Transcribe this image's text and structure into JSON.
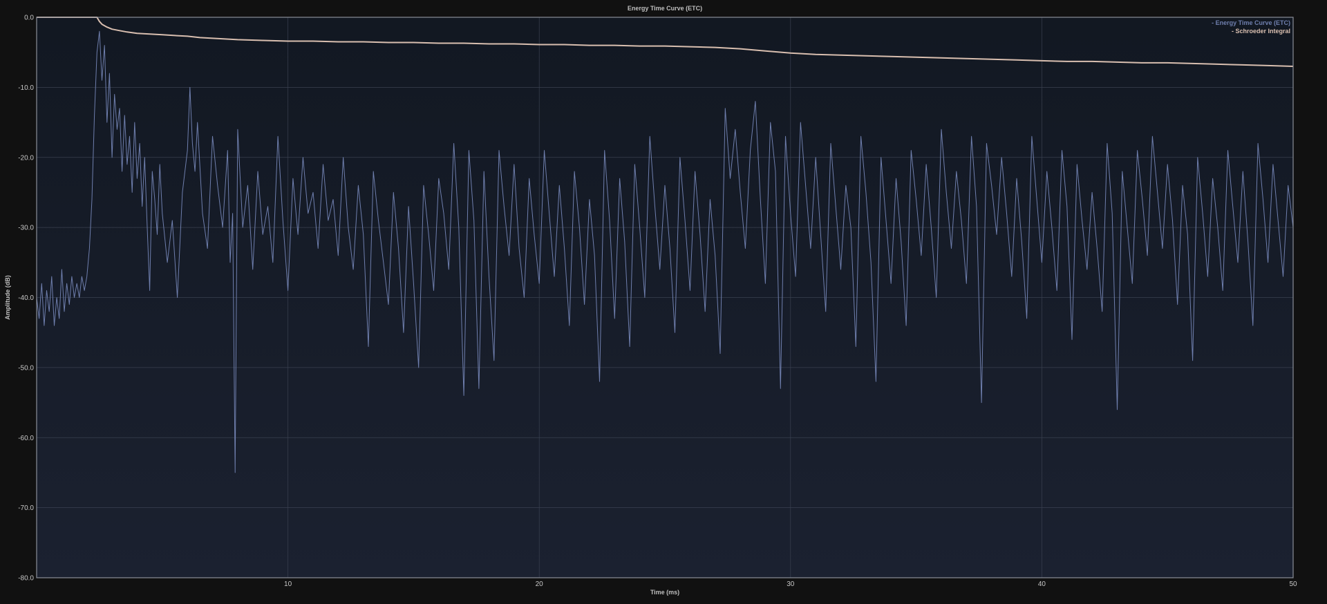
{
  "chart_data": {
    "type": "line",
    "title": "Energy Time Curve (ETC)",
    "xlabel": "Time (ms)",
    "ylabel": "Amplitude (dB)",
    "xlim": [
      0,
      50
    ],
    "ylim": [
      -80,
      0
    ],
    "x_ticks": [
      10,
      20,
      30,
      40,
      50
    ],
    "x_tick_labels": [
      "10",
      "20",
      "30",
      "40",
      "50"
    ],
    "y_ticks": [
      0,
      -10,
      -20,
      -30,
      -40,
      -50,
      -60,
      -70,
      -80
    ],
    "y_tick_labels": [
      "0.0",
      "-10.0",
      "-20.0",
      "-30.0",
      "-40.0",
      "-50.0",
      "-60.0",
      "-70.0",
      "-80.0"
    ],
    "grid": true,
    "legend_position": "top-right",
    "background": "#151b27",
    "grid_color": "#3a4150",
    "axis_color": "#8a8f99",
    "series": [
      {
        "name": "Energy Time Curve (ETC)",
        "legend_label": "- Energy Time Curve (ETC)",
        "color": "#6f7fae",
        "x": [
          0,
          0.1,
          0.2,
          0.3,
          0.4,
          0.5,
          0.6,
          0.7,
          0.8,
          0.9,
          1.0,
          1.1,
          1.2,
          1.3,
          1.4,
          1.5,
          1.6,
          1.7,
          1.8,
          1.9,
          2.0,
          2.1,
          2.2,
          2.3,
          2.4,
          2.5,
          2.6,
          2.7,
          2.8,
          2.9,
          3.0,
          3.1,
          3.2,
          3.3,
          3.4,
          3.5,
          3.6,
          3.7,
          3.8,
          3.9,
          4.0,
          4.1,
          4.2,
          4.3,
          4.4,
          4.5,
          4.6,
          4.7,
          4.8,
          4.9,
          5.0,
          5.2,
          5.4,
          5.6,
          5.8,
          6.0,
          6.1,
          6.2,
          6.3,
          6.4,
          6.6,
          6.8,
          7.0,
          7.2,
          7.4,
          7.6,
          7.7,
          7.8,
          7.9,
          8.0,
          8.2,
          8.4,
          8.6,
          8.8,
          9.0,
          9.2,
          9.4,
          9.6,
          9.8,
          10.0,
          10.2,
          10.4,
          10.6,
          10.8,
          11.0,
          11.2,
          11.4,
          11.6,
          11.8,
          12.0,
          12.2,
          12.4,
          12.6,
          12.8,
          13.0,
          13.2,
          13.4,
          13.6,
          13.8,
          14.0,
          14.2,
          14.4,
          14.6,
          14.8,
          15.0,
          15.2,
          15.4,
          15.6,
          15.8,
          16.0,
          16.2,
          16.4,
          16.6,
          16.8,
          17.0,
          17.2,
          17.4,
          17.6,
          17.8,
          18.0,
          18.2,
          18.4,
          18.6,
          18.8,
          19.0,
          19.2,
          19.4,
          19.6,
          19.8,
          20.0,
          20.2,
          20.4,
          20.6,
          20.8,
          21.0,
          21.2,
          21.4,
          21.6,
          21.8,
          22.0,
          22.2,
          22.4,
          22.6,
          22.8,
          23.0,
          23.2,
          23.4,
          23.6,
          23.8,
          24.0,
          24.2,
          24.4,
          24.6,
          24.8,
          25.0,
          25.2,
          25.4,
          25.6,
          25.8,
          26.0,
          26.2,
          26.4,
          26.6,
          26.8,
          27.0,
          27.2,
          27.4,
          27.6,
          27.8,
          28.0,
          28.2,
          28.4,
          28.6,
          28.8,
          29.0,
          29.2,
          29.4,
          29.6,
          29.8,
          30.0,
          30.2,
          30.4,
          30.6,
          30.8,
          31.0,
          31.2,
          31.4,
          31.6,
          31.8,
          32.0,
          32.2,
          32.4,
          32.6,
          32.8,
          33.0,
          33.2,
          33.4,
          33.6,
          33.8,
          34.0,
          34.2,
          34.4,
          34.6,
          34.8,
          35.0,
          35.2,
          35.4,
          35.6,
          35.8,
          36.0,
          36.2,
          36.4,
          36.6,
          36.8,
          37.0,
          37.2,
          37.4,
          37.6,
          37.8,
          38.0,
          38.2,
          38.4,
          38.6,
          38.8,
          39.0,
          39.2,
          39.4,
          39.6,
          39.8,
          40.0,
          40.2,
          40.4,
          40.6,
          40.8,
          41.0,
          41.2,
          41.4,
          41.6,
          41.8,
          42.0,
          42.2,
          42.4,
          42.6,
          42.8,
          43.0,
          43.2,
          43.4,
          43.6,
          43.8,
          44.0,
          44.2,
          44.4,
          44.6,
          44.8,
          45.0,
          45.2,
          45.4,
          45.6,
          45.8,
          46.0,
          46.2,
          46.4,
          46.6,
          46.8,
          47.0,
          47.2,
          47.4,
          47.6,
          47.8,
          48.0,
          48.2,
          48.4,
          48.6,
          48.8,
          49.0,
          49.2,
          49.4,
          49.6,
          49.8,
          50.0
        ],
        "values": [
          -40,
          -43,
          -38,
          -44,
          -39,
          -42,
          -37,
          -44,
          -40,
          -43,
          -36,
          -42,
          -38,
          -41,
          -37,
          -40,
          -38,
          -40,
          -37,
          -39,
          -37,
          -33,
          -26,
          -14,
          -5,
          -2,
          -9,
          -4,
          -15,
          -8,
          -20,
          -11,
          -16,
          -13,
          -22,
          -14,
          -21,
          -17,
          -25,
          -15,
          -23,
          -18,
          -27,
          -20,
          -30,
          -39,
          -22,
          -26,
          -31,
          -21,
          -28,
          -35,
          -29,
          -40,
          -25,
          -19,
          -10,
          -18,
          -22,
          -15,
          -28,
          -33,
          -17,
          -24,
          -30,
          -19,
          -35,
          -28,
          -65,
          -16,
          -30,
          -24,
          -36,
          -22,
          -31,
          -27,
          -35,
          -17,
          -29,
          -39,
          -23,
          -31,
          -20,
          -28,
          -25,
          -33,
          -21,
          -29,
          -26,
          -34,
          -20,
          -30,
          -36,
          -24,
          -31,
          -47,
          -22,
          -29,
          -35,
          -41,
          -25,
          -33,
          -45,
          -27,
          -38,
          -50,
          -24,
          -31,
          -39,
          -23,
          -28,
          -36,
          -18,
          -30,
          -54,
          -19,
          -29,
          -53,
          -22,
          -37,
          -49,
          -19,
          -27,
          -34,
          -21,
          -33,
          -40,
          -23,
          -31,
          -38,
          -19,
          -28,
          -37,
          -24,
          -33,
          -44,
          -22,
          -30,
          -41,
          -26,
          -34,
          -52,
          -19,
          -29,
          -43,
          -23,
          -32,
          -47,
          -21,
          -30,
          -40,
          -17,
          -27,
          -36,
          -24,
          -33,
          -45,
          -20,
          -29,
          -39,
          -22,
          -31,
          -42,
          -26,
          -34,
          -48,
          -13,
          -23,
          -16,
          -25,
          -33,
          -19,
          -12,
          -26,
          -38,
          -15,
          -22,
          -53,
          -17,
          -28,
          -37,
          -15,
          -24,
          -33,
          -20,
          -31,
          -42,
          -18,
          -27,
          -36,
          -24,
          -30,
          -47,
          -17,
          -25,
          -35,
          -52,
          -20,
          -29,
          -38,
          -23,
          -32,
          -44,
          -19,
          -26,
          -34,
          -21,
          -30,
          -40,
          -16,
          -25,
          -33,
          -22,
          -29,
          -38,
          -17,
          -27,
          -55,
          -18,
          -24,
          -31,
          -20,
          -28,
          -37,
          -23,
          -32,
          -43,
          -17,
          -26,
          -35,
          -22,
          -30,
          -39,
          -19,
          -27,
          -46,
          -21,
          -29,
          -36,
          -25,
          -33,
          -42,
          -18,
          -28,
          -56,
          -22,
          -30,
          -38,
          -19,
          -26,
          -34,
          -17,
          -25,
          -33,
          -21,
          -29,
          -41,
          -24,
          -31,
          -49,
          -20,
          -28,
          -37,
          -23,
          -30,
          -39,
          -19,
          -27,
          -35,
          -22,
          -32,
          -44,
          -18,
          -26,
          -35,
          -21,
          -29,
          -37,
          -24,
          -30
        ]
      },
      {
        "name": "Schroeder Integral",
        "legend_label": "- Schroeder Integral",
        "color": "#d9bfb0",
        "x": [
          0,
          2.4,
          2.5,
          2.6,
          2.8,
          3.0,
          3.3,
          3.6,
          4.0,
          4.5,
          5.0,
          5.5,
          6.0,
          6.5,
          7.0,
          8.0,
          9.0,
          10.0,
          11.0,
          12.0,
          13.0,
          14.0,
          15.0,
          16.0,
          17.0,
          18.0,
          19.0,
          20.0,
          21.0,
          22.0,
          23.0,
          24.0,
          25.0,
          26.0,
          27.0,
          28.0,
          29.0,
          30.0,
          31.0,
          32.0,
          33.0,
          34.0,
          35.0,
          36.0,
          37.0,
          38.0,
          39.0,
          40.0,
          41.0,
          42.0,
          43.0,
          44.0,
          45.0,
          46.0,
          47.0,
          48.0,
          49.0,
          50.0
        ],
        "values": [
          0,
          0,
          -0.6,
          -1.0,
          -1.4,
          -1.7,
          -1.9,
          -2.1,
          -2.3,
          -2.4,
          -2.5,
          -2.6,
          -2.7,
          -2.9,
          -3.0,
          -3.2,
          -3.3,
          -3.4,
          -3.4,
          -3.5,
          -3.5,
          -3.6,
          -3.6,
          -3.7,
          -3.7,
          -3.8,
          -3.8,
          -3.9,
          -3.9,
          -4.0,
          -4.0,
          -4.1,
          -4.1,
          -4.2,
          -4.3,
          -4.5,
          -4.8,
          -5.1,
          -5.3,
          -5.4,
          -5.5,
          -5.6,
          -5.7,
          -5.8,
          -5.9,
          -6.0,
          -6.1,
          -6.2,
          -6.3,
          -6.3,
          -6.4,
          -6.5,
          -6.5,
          -6.6,
          -6.7,
          -6.8,
          -6.9,
          -7.0
        ]
      }
    ]
  }
}
